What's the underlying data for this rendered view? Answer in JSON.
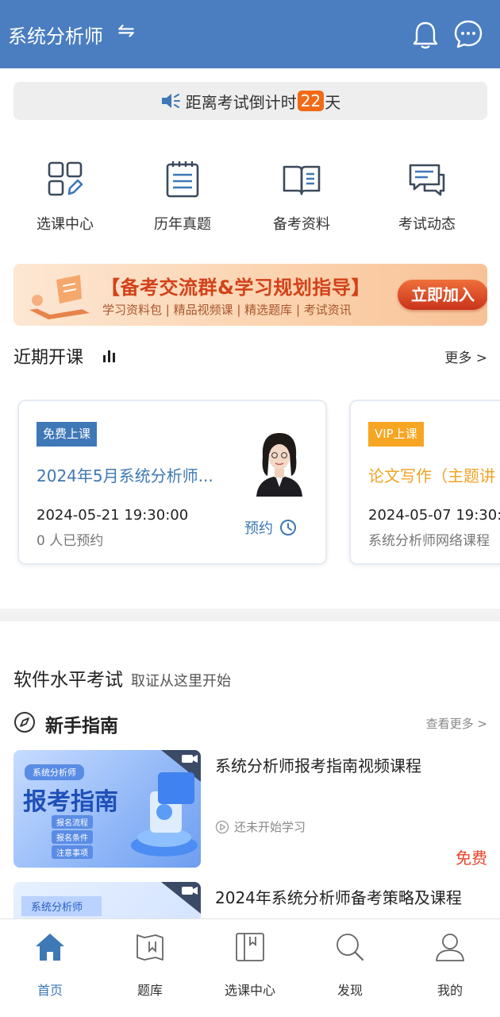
{
  "header": {
    "title": "系统分析师",
    "swap_symbol": "⇋"
  },
  "countdown": {
    "prefix": "距离考试倒计时",
    "days": "22",
    "suffix": "天"
  },
  "quick_entries": [
    {
      "label": "选课中心",
      "icon": "grid-icon"
    },
    {
      "label": "历年真题",
      "icon": "notepad-icon"
    },
    {
      "label": "备考资料",
      "icon": "open-book-icon"
    },
    {
      "label": "考试动态",
      "icon": "chat-news-icon"
    }
  ],
  "banner": {
    "title": "【备考交流群&学习规划指导】",
    "subtitle": "学习资料包 | 精品视频课 | 精选题库 | 考试资讯",
    "button": "立即加入"
  },
  "recent": {
    "title": "近期开课",
    "more": "更多 >",
    "courses": [
      {
        "tag": "免费上课",
        "title": "2024年5月系统分析师...",
        "time": "2024-05-21 19:30:00",
        "sub": "0 人已预约",
        "action": "预约"
      },
      {
        "tag": "VIP上课",
        "title": "论文写作（主题讲",
        "time": "2024-05-07 19:30:0",
        "sub": "系统分析师网络课程"
      }
    ]
  },
  "exam": {
    "title": "软件水平考试",
    "subtitle": "取证从这里开始"
  },
  "guide": {
    "title": "新手指南",
    "more": "查看更多 >",
    "lessons": [
      {
        "title": "系统分析师报考指南视频课程",
        "status": "还未开始学习",
        "price": "免费",
        "thumb": {
          "badge": "系统分析师",
          "headline": "报考指南",
          "items": [
            "报名流程",
            "报名条件",
            "注意事项"
          ]
        }
      },
      {
        "title": "2024年系统分析师备考策略及课程",
        "thumb": {
          "badge": "系统分析师"
        }
      }
    ]
  },
  "tabbar": [
    {
      "label": "首页",
      "active": true
    },
    {
      "label": "题库"
    },
    {
      "label": "选课中心"
    },
    {
      "label": "发现"
    },
    {
      "label": "我的"
    }
  ],
  "colors": {
    "primary": "#4a7ec1",
    "accent_orange": "#f26a18",
    "vip": "#f6a623",
    "price_red": "#e8452b"
  }
}
